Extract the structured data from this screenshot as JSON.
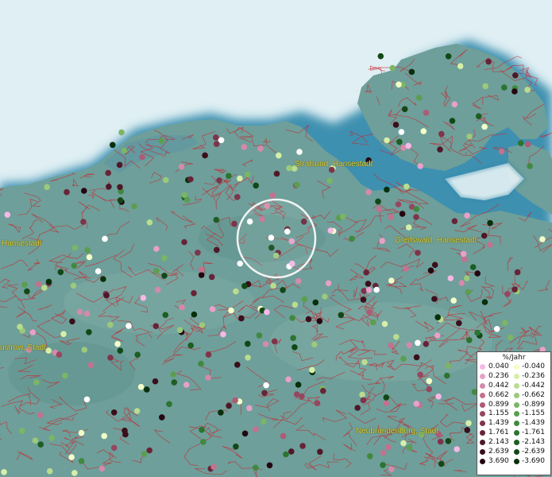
{
  "cities": [
    {
      "name": "Stralsund, Hansestadt"
    },
    {
      "name": "Greifswald, Hansestadt"
    },
    {
      "name": "Neubrandenburg, Stadt"
    },
    {
      "name": "Hansestadt"
    },
    {
      "name": "ustrow, Stadt"
    }
  ],
  "legend": {
    "title": "%/Jahr",
    "positive_values": [
      "0.040",
      "0.236",
      "0.442",
      "0.662",
      "0.899",
      "1.155",
      "1.439",
      "1.761",
      "2.143",
      "2.639",
      "3.690"
    ],
    "negative_values": [
      "-0.040",
      "-0.236",
      "-0.442",
      "-0.662",
      "-0.899",
      "-1.155",
      "-1.439",
      "-1.761",
      "-2.143",
      "-2.639",
      "-3.690"
    ],
    "positive_colors": [
      "#f6b8e6",
      "#e7a0c8",
      "#d48aab",
      "#c2728f",
      "#ad5b76",
      "#964760",
      "#7e344a",
      "#672438",
      "#4f1828",
      "#3a0e1b",
      "#240611"
    ],
    "negative_colors": [
      "#f2ffc8",
      "#d6efa8",
      "#b9dc8e",
      "#9cc97a",
      "#7cb566",
      "#5b9e50",
      "#40893f",
      "#2c7430",
      "#1d5e22",
      "#124816",
      "#08300c"
    ]
  },
  "colors": {
    "water": "#dfeff3",
    "land": "#6e9f9a",
    "coast": "#1f6f93",
    "boundaries": "#c8242e",
    "label": "#e0d23a"
  },
  "icons": {
    "marker": "circle-marker-icon",
    "focus": "focus-ring-icon"
  }
}
